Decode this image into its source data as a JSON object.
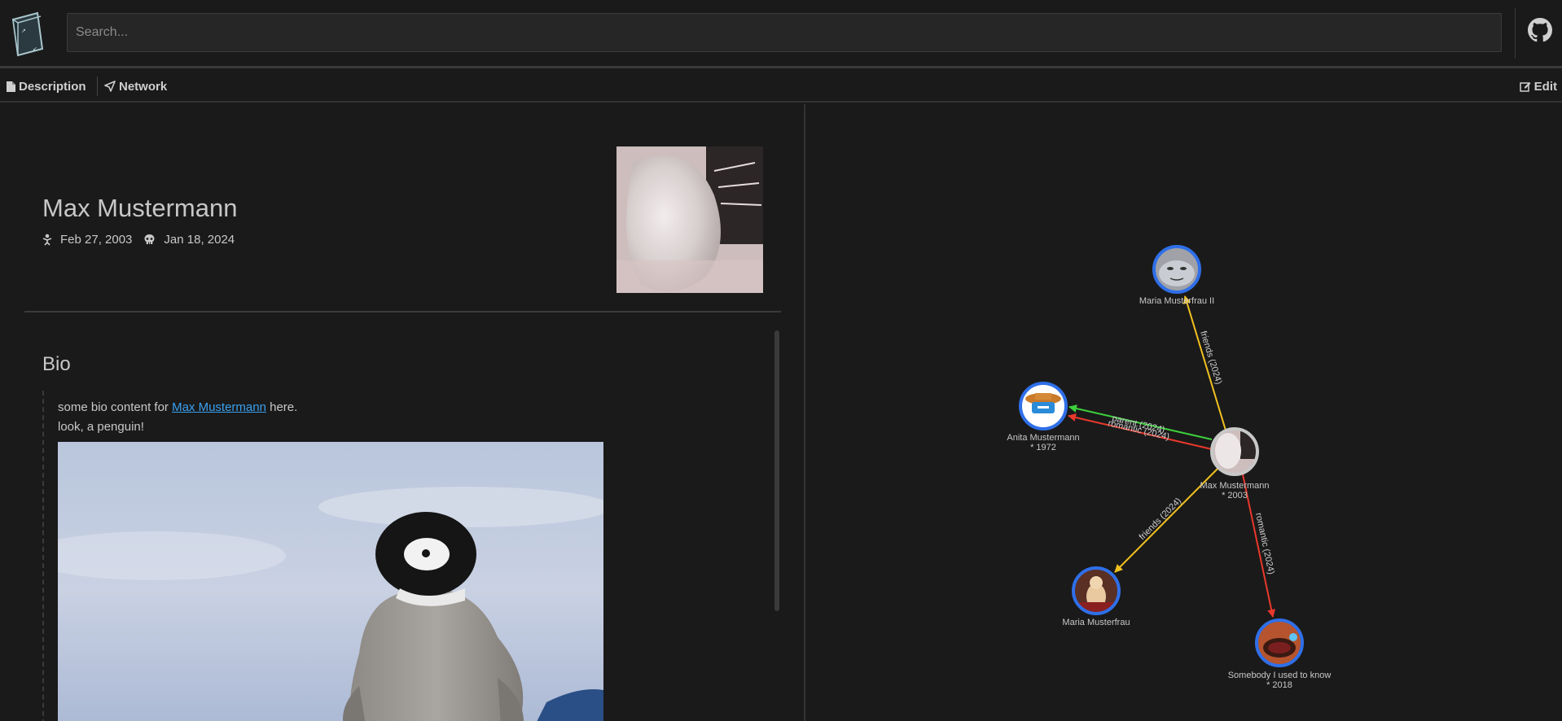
{
  "search": {
    "placeholder": "Search..."
  },
  "tabs": {
    "description": "Description",
    "network": "Network",
    "edit": "Edit"
  },
  "person": {
    "name": "Max Mustermann",
    "birth_date": "Feb 27, 2003",
    "death_date": "Jan 18, 2024"
  },
  "bio": {
    "title": "Bio",
    "line1_prefix": "some bio content for ",
    "line1_link": "Max Mustermann",
    "line1_suffix": " here.",
    "line2": "look, a penguin!"
  },
  "network": {
    "nodes": {
      "maria2": {
        "name": "Maria Musterfrau II",
        "sub": ""
      },
      "anita": {
        "name": "Anita Mustermann",
        "sub": "* 1972"
      },
      "max": {
        "name": "Max Mustermann",
        "sub": "* 2003"
      },
      "maria": {
        "name": "Maria Musterfrau",
        "sub": ""
      },
      "somebody": {
        "name": "Somebody I used to know",
        "sub": "* 2018"
      }
    },
    "edges": {
      "max_maria2": "friends (2024)",
      "max_anita_parent": "parent (2024)",
      "max_anita_romantic": "romantic (2024)",
      "max_maria": "friends (2024)",
      "max_somebody": "romantic (2024)"
    },
    "colors": {
      "friends": "#f0c020",
      "romantic": "#e8382c",
      "parent": "#3cd03c",
      "node_ring": "#2f6fe8"
    }
  }
}
